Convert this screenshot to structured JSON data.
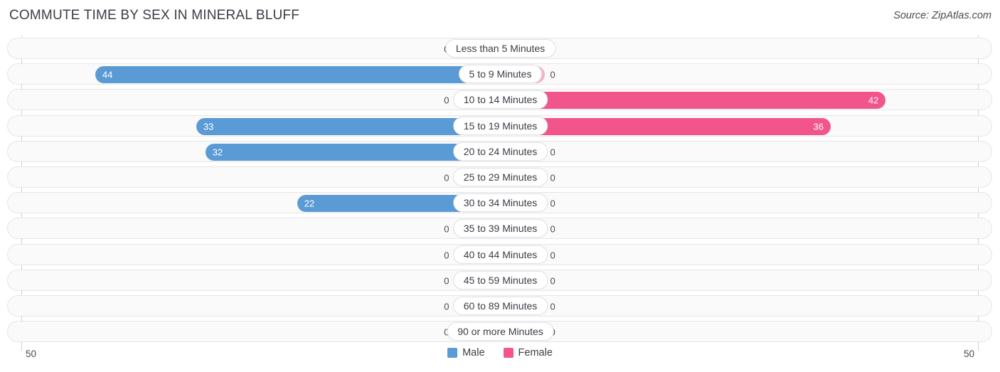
{
  "header": {
    "title": "COMMUTE TIME BY SEX IN MINERAL BLUFF",
    "source": "Source: ZipAtlas.com"
  },
  "axis": {
    "left_label": "50",
    "right_label": "50"
  },
  "legend": {
    "items": [
      {
        "label": "Male",
        "color": "#5b9bd5"
      },
      {
        "label": "Female",
        "color": "#f2558c"
      }
    ]
  },
  "colors": {
    "male": "#5b9bd5",
    "male_zero": "#aecbeb",
    "female": "#f2558c",
    "female_zero": "#f7b2c9",
    "track": "#fafafa",
    "track_border": "#e6e6e6",
    "text": "#3c3c46"
  },
  "chart_data": {
    "type": "bar",
    "orientation": "horizontal-diverging",
    "title": "COMMUTE TIME BY SEX IN MINERAL BLUFF",
    "xlabel": "",
    "ylabel": "",
    "xlim": [
      50,
      50
    ],
    "axis_max": 50,
    "grid": false,
    "legend_position": "bottom-center",
    "categories": [
      "Less than 5 Minutes",
      "5 to 9 Minutes",
      "10 to 14 Minutes",
      "15 to 19 Minutes",
      "20 to 24 Minutes",
      "25 to 29 Minutes",
      "30 to 34 Minutes",
      "35 to 39 Minutes",
      "40 to 44 Minutes",
      "45 to 59 Minutes",
      "60 to 89 Minutes",
      "90 or more Minutes"
    ],
    "series": [
      {
        "name": "Male",
        "values": [
          0,
          44,
          0,
          33,
          32,
          0,
          22,
          0,
          0,
          0,
          0,
          0
        ]
      },
      {
        "name": "Female",
        "values": [
          0,
          0,
          42,
          36,
          0,
          0,
          0,
          0,
          0,
          0,
          0,
          0
        ]
      }
    ]
  },
  "rows": [
    {
      "category": "Less than 5 Minutes",
      "male": 0,
      "male_text": "0",
      "female": 0,
      "female_text": "0"
    },
    {
      "category": "5 to 9 Minutes",
      "male": 44,
      "male_text": "44",
      "female": 0,
      "female_text": "0"
    },
    {
      "category": "10 to 14 Minutes",
      "male": 0,
      "male_text": "0",
      "female": 42,
      "female_text": "42"
    },
    {
      "category": "15 to 19 Minutes",
      "male": 33,
      "male_text": "33",
      "female": 36,
      "female_text": "36"
    },
    {
      "category": "20 to 24 Minutes",
      "male": 32,
      "male_text": "32",
      "female": 0,
      "female_text": "0"
    },
    {
      "category": "25 to 29 Minutes",
      "male": 0,
      "male_text": "0",
      "female": 0,
      "female_text": "0"
    },
    {
      "category": "30 to 34 Minutes",
      "male": 22,
      "male_text": "22",
      "female": 0,
      "female_text": "0"
    },
    {
      "category": "35 to 39 Minutes",
      "male": 0,
      "male_text": "0",
      "female": 0,
      "female_text": "0"
    },
    {
      "category": "40 to 44 Minutes",
      "male": 0,
      "male_text": "0",
      "female": 0,
      "female_text": "0"
    },
    {
      "category": "45 to 59 Minutes",
      "male": 0,
      "male_text": "0",
      "female": 0,
      "female_text": "0"
    },
    {
      "category": "60 to 89 Minutes",
      "male": 0,
      "male_text": "0",
      "female": 0,
      "female_text": "0"
    },
    {
      "category": "90 or more Minutes",
      "male": 0,
      "male_text": "0",
      "female": 0,
      "female_text": "0"
    }
  ]
}
